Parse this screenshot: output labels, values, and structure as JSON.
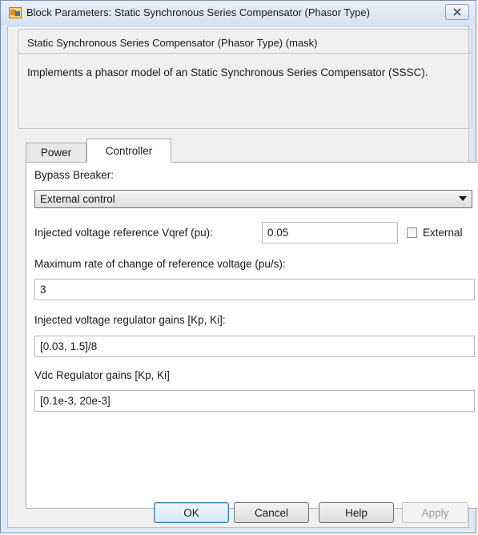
{
  "window": {
    "title": "Block Parameters: Static Synchronous Series Compensator (Phasor Type)"
  },
  "mask": {
    "title": "Static Synchronous Series Compensator (Phasor Type) (mask)",
    "description": "Implements a phasor model of an Static Synchronous Series Compensator (SSSC)."
  },
  "tabs": [
    {
      "label": "Power",
      "active": false
    },
    {
      "label": "Controller",
      "active": true
    }
  ],
  "controller": {
    "bypass_breaker_label": "Bypass Breaker:",
    "bypass_breaker_value": "External control",
    "vqref_label": "Injected voltage reference Vqref (pu):",
    "vqref_value": "0.05",
    "external_label": "External",
    "external_checked": false,
    "max_rate_label": "Maximum rate of change of reference voltage (pu/s):",
    "max_rate_value": "3",
    "inj_gains_label": "Injected voltage regulator gains [Kp, Ki]:",
    "inj_gains_value": "[0.03, 1.5]/8",
    "vdc_gains_label": "Vdc Regulator gains [Kp, Ki]",
    "vdc_gains_value": "[0.1e-3, 20e-3]"
  },
  "buttons": {
    "ok": "OK",
    "cancel": "Cancel",
    "help": "Help",
    "apply": "Apply"
  },
  "icons": {
    "app": "simulink-block-icon",
    "close": "close-icon",
    "dropdown": "chevron-down-icon"
  }
}
